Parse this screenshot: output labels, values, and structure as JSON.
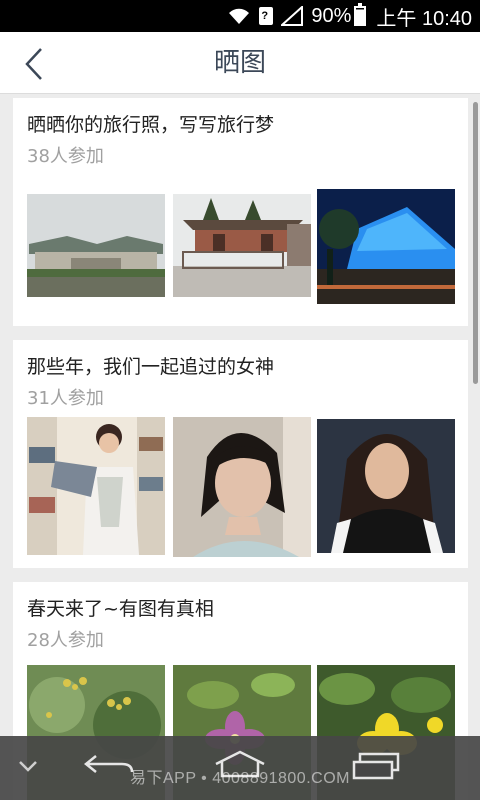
{
  "status_bar": {
    "battery_percent": "90%",
    "time": "上午 10:40"
  },
  "header": {
    "title": "晒图"
  },
  "topics": [
    {
      "title": "晒晒你的旅行照，写写旅行梦",
      "count": "38人参加"
    },
    {
      "title": "那些年，我们一起追过的女神",
      "count": "31人参加"
    },
    {
      "title": "春天来了~有图有真相",
      "count": "28人参加"
    }
  ],
  "bottom_bar": {
    "watermark": "易下APP • 4008891800.COM"
  },
  "colors": {
    "accent_text": "#3c4858",
    "count_text": "#a0a0a0",
    "background": "#ececec"
  }
}
